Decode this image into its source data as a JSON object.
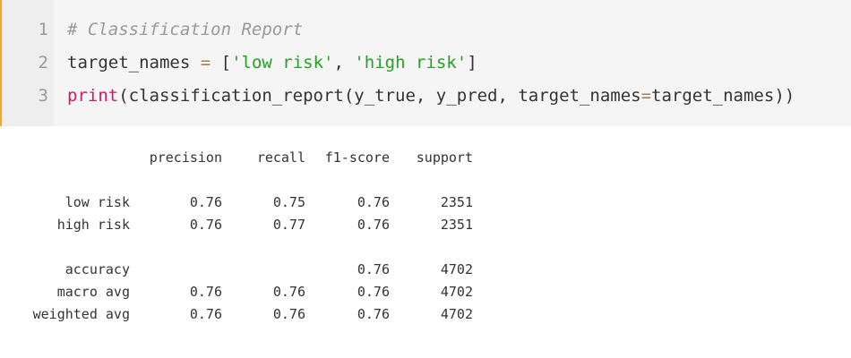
{
  "code_cell": {
    "line_numbers": [
      "1",
      "2",
      "3"
    ],
    "line1": {
      "comment": "# Classification Report"
    },
    "line2": {
      "var": "target_names",
      "eq": " = ",
      "open": "[",
      "s1": "'low risk'",
      "sep": ", ",
      "s2": "'high risk'",
      "close": "]"
    },
    "line3": {
      "fn": "print",
      "args_a": "(classification_report(y_true, y_pred, target_names",
      "eq": "=",
      "args_b": "target_names))"
    }
  },
  "report": {
    "headers": [
      "precision",
      "recall",
      "f1-score",
      "support"
    ],
    "rows": [
      {
        "label": "low risk",
        "precision": "0.76",
        "recall": "0.75",
        "f1": "0.76",
        "support": "2351"
      },
      {
        "label": "high risk",
        "precision": "0.76",
        "recall": "0.77",
        "f1": "0.76",
        "support": "2351"
      },
      {
        "label": "accuracy",
        "precision": "",
        "recall": "",
        "f1": "0.76",
        "support": "4702"
      },
      {
        "label": "macro avg",
        "precision": "0.76",
        "recall": "0.76",
        "f1": "0.76",
        "support": "4702"
      },
      {
        "label": "weighted avg",
        "precision": "0.76",
        "recall": "0.76",
        "f1": "0.76",
        "support": "4702"
      }
    ]
  }
}
